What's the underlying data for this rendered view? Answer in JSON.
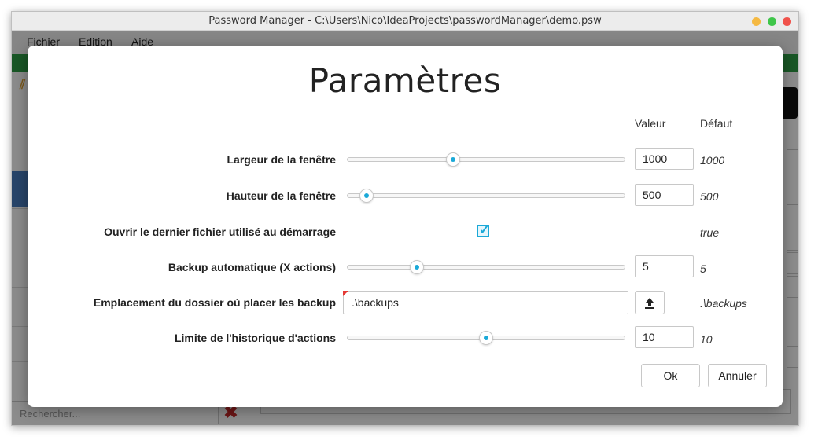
{
  "window": {
    "title": "Password Manager - C:\\Users\\Nico\\IdeaProjects\\passwordManager\\demo.psw"
  },
  "menu": {
    "items": [
      "Fichier",
      "Edition",
      "Aide"
    ]
  },
  "background": {
    "search_placeholder": "Rechercher..."
  },
  "dialog": {
    "title": "Paramètres",
    "col_value": "Valeur",
    "col_default": "Défaut",
    "rows": [
      {
        "label": "Largeur de la fenêtre",
        "value": "1000",
        "default": "1000",
        "slider_pos": 0.38
      },
      {
        "label": "Hauteur de la fenêtre",
        "value": "500",
        "default": "500",
        "slider_pos": 0.07
      },
      {
        "label": "Ouvrir le dernier fichier utilisé au démarrage",
        "checked": true,
        "default": "true"
      },
      {
        "label": "Backup automatique (X actions)",
        "value": "5",
        "default": "5",
        "slider_pos": 0.25
      },
      {
        "label": "Emplacement du dossier où placer les backup",
        "value": ".\\backups",
        "default": ".\\backups"
      },
      {
        "label": "Limite de l'historique d'actions",
        "value": "10",
        "default": "10",
        "slider_pos": 0.5
      }
    ],
    "ok_label": "Ok",
    "cancel_label": "Annuler"
  },
  "colors": {
    "accent": "#1ba9d8",
    "toolbar_green": "#2e9e45",
    "error_red": "#e53935"
  }
}
